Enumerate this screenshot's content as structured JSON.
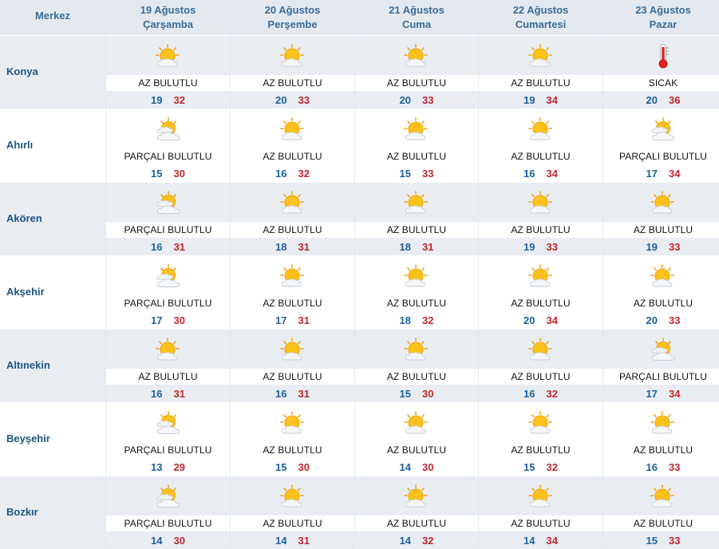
{
  "header": {
    "first_col": "Merkez",
    "days": [
      {
        "date": "19 Ağustos",
        "weekday": "Çarşamba"
      },
      {
        "date": "20 Ağustos",
        "weekday": "Perşembe"
      },
      {
        "date": "21 Ağustos",
        "weekday": "Cuma"
      },
      {
        "date": "22 Ağustos",
        "weekday": "Cumartesi"
      },
      {
        "date": "23 Ağustos",
        "weekday": "Pazar"
      }
    ]
  },
  "rows": [
    {
      "city": "Konya",
      "days": [
        {
          "icon": "partly-sunny-icon",
          "desc": "AZ BULUTLU",
          "min": "19",
          "max": "32"
        },
        {
          "icon": "partly-sunny-icon",
          "desc": "AZ BULUTLU",
          "min": "20",
          "max": "33"
        },
        {
          "icon": "partly-sunny-icon",
          "desc": "AZ BULUTLU",
          "min": "20",
          "max": "33"
        },
        {
          "icon": "partly-sunny-icon",
          "desc": "AZ BULUTLU",
          "min": "19",
          "max": "34"
        },
        {
          "icon": "thermometer-hot-icon",
          "desc": "SICAK",
          "min": "20",
          "max": "36"
        }
      ]
    },
    {
      "city": "Ahırlı",
      "days": [
        {
          "icon": "partly-cloudy-icon",
          "desc": "PARÇALI BULUTLU",
          "min": "15",
          "max": "30"
        },
        {
          "icon": "partly-sunny-icon",
          "desc": "AZ BULUTLU",
          "min": "16",
          "max": "32"
        },
        {
          "icon": "partly-sunny-icon",
          "desc": "AZ BULUTLU",
          "min": "15",
          "max": "33"
        },
        {
          "icon": "partly-sunny-icon",
          "desc": "AZ BULUTLU",
          "min": "16",
          "max": "34"
        },
        {
          "icon": "partly-cloudy-icon",
          "desc": "PARÇALI BULUTLU",
          "min": "17",
          "max": "34"
        }
      ]
    },
    {
      "city": "Akören",
      "days": [
        {
          "icon": "partly-cloudy-icon",
          "desc": "PARÇALI BULUTLU",
          "min": "16",
          "max": "31"
        },
        {
          "icon": "partly-sunny-icon",
          "desc": "AZ BULUTLU",
          "min": "18",
          "max": "31"
        },
        {
          "icon": "partly-sunny-icon",
          "desc": "AZ BULUTLU",
          "min": "18",
          "max": "31"
        },
        {
          "icon": "partly-sunny-icon",
          "desc": "AZ BULUTLU",
          "min": "19",
          "max": "33"
        },
        {
          "icon": "partly-sunny-icon",
          "desc": "AZ BULUTLU",
          "min": "19",
          "max": "33"
        }
      ]
    },
    {
      "city": "Akşehir",
      "days": [
        {
          "icon": "partly-cloudy-icon",
          "desc": "PARÇALI BULUTLU",
          "min": "17",
          "max": "30"
        },
        {
          "icon": "partly-sunny-icon",
          "desc": "AZ BULUTLU",
          "min": "17",
          "max": "31"
        },
        {
          "icon": "partly-sunny-icon",
          "desc": "AZ BULUTLU",
          "min": "18",
          "max": "32"
        },
        {
          "icon": "partly-sunny-icon",
          "desc": "AZ BULUTLU",
          "min": "20",
          "max": "34"
        },
        {
          "icon": "partly-sunny-icon",
          "desc": "AZ BULUTLU",
          "min": "20",
          "max": "33"
        }
      ]
    },
    {
      "city": "Altınekin",
      "days": [
        {
          "icon": "partly-sunny-icon",
          "desc": "AZ BULUTLU",
          "min": "16",
          "max": "31"
        },
        {
          "icon": "partly-sunny-icon",
          "desc": "AZ BULUTLU",
          "min": "16",
          "max": "31"
        },
        {
          "icon": "partly-sunny-icon",
          "desc": "AZ BULUTLU",
          "min": "15",
          "max": "30"
        },
        {
          "icon": "partly-sunny-icon",
          "desc": "AZ BULUTLU",
          "min": "16",
          "max": "32"
        },
        {
          "icon": "partly-cloudy-icon",
          "desc": "PARÇALI BULUTLU",
          "min": "17",
          "max": "34"
        }
      ]
    },
    {
      "city": "Beyşehir",
      "days": [
        {
          "icon": "partly-cloudy-icon",
          "desc": "PARÇALI BULUTLU",
          "min": "13",
          "max": "29"
        },
        {
          "icon": "partly-sunny-icon",
          "desc": "AZ BULUTLU",
          "min": "15",
          "max": "30"
        },
        {
          "icon": "partly-sunny-icon",
          "desc": "AZ BULUTLU",
          "min": "14",
          "max": "30"
        },
        {
          "icon": "partly-sunny-icon",
          "desc": "AZ BULUTLU",
          "min": "15",
          "max": "32"
        },
        {
          "icon": "partly-sunny-icon",
          "desc": "AZ BULUTLU",
          "min": "16",
          "max": "33"
        }
      ]
    },
    {
      "city": "Bozkır",
      "days": [
        {
          "icon": "partly-cloudy-icon",
          "desc": "PARÇALI BULUTLU",
          "min": "14",
          "max": "30"
        },
        {
          "icon": "partly-sunny-icon",
          "desc": "AZ BULUTLU",
          "min": "14",
          "max": "31"
        },
        {
          "icon": "partly-sunny-icon",
          "desc": "AZ BULUTLU",
          "min": "14",
          "max": "32"
        },
        {
          "icon": "partly-sunny-icon",
          "desc": "AZ BULUTLU",
          "min": "14",
          "max": "34"
        },
        {
          "icon": "partly-sunny-icon",
          "desc": "AZ BULUTLU",
          "min": "15",
          "max": "33"
        }
      ]
    }
  ],
  "colors": {
    "header_text": "#3a6c95",
    "city_text": "#1f5582",
    "min_temp": "#1d5f9e",
    "max_temp": "#c0262d",
    "row_alt_bg": "#e9edf2"
  }
}
